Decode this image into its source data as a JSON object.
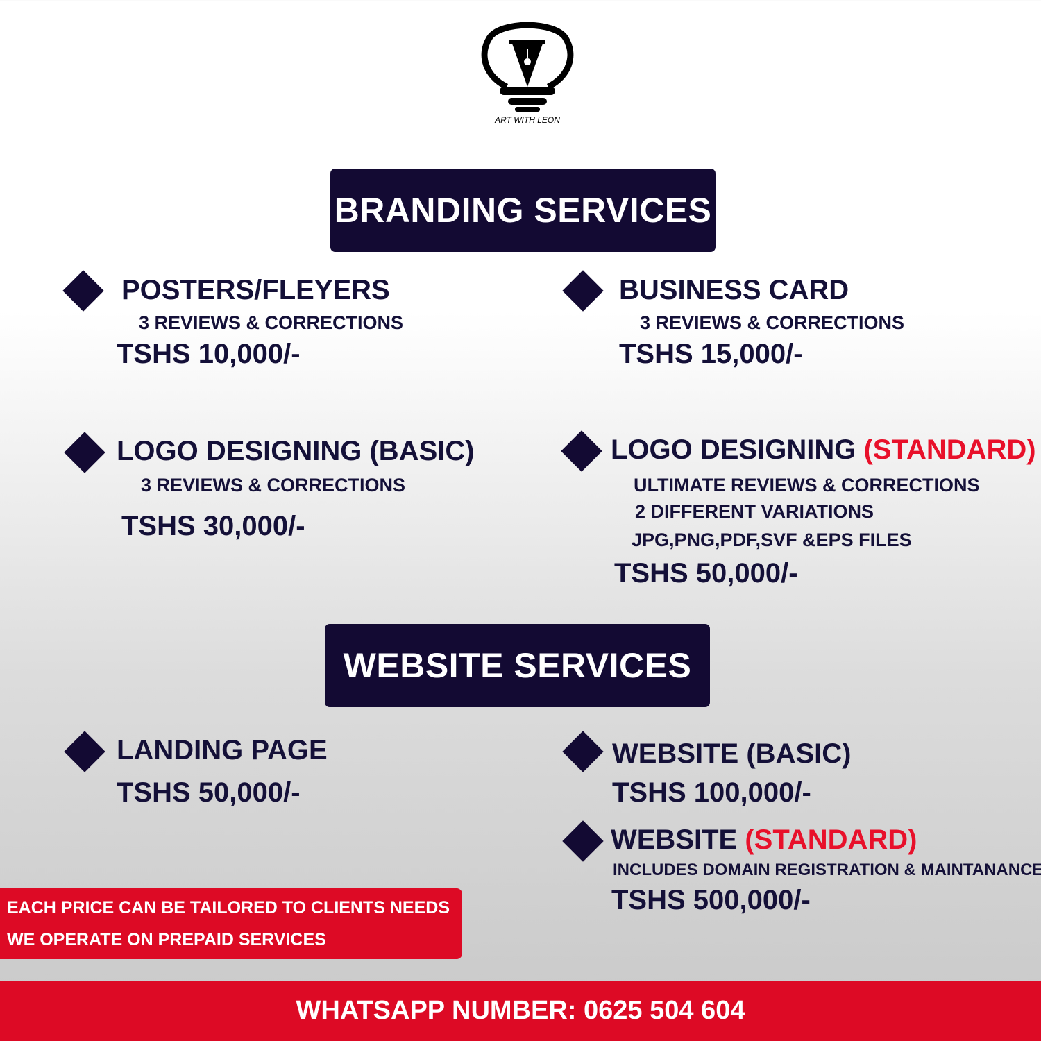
{
  "brand": {
    "logo_text": "ART WITH LEON"
  },
  "branding": {
    "heading": "BRANDING SERVICES",
    "posters": {
      "title": "POSTERS/FLEYERS",
      "detail": "3 REVIEWS & CORRECTIONS",
      "price": "TSHS 10,000/-"
    },
    "business_card": {
      "title": "BUSINESS CARD",
      "detail": "3 REVIEWS & CORRECTIONS",
      "price": "TSHS 15,000/-"
    },
    "logo_basic": {
      "title": "LOGO DESIGNING",
      "tier": "(BASIC)",
      "detail": "3 REVIEWS & CORRECTIONS",
      "price": "TSHS 30,000/-"
    },
    "logo_standard": {
      "title": "LOGO DESIGNING",
      "tier": "(STANDARD)",
      "details": [
        "ULTIMATE REVIEWS & CORRECTIONS",
        "2 DIFFERENT VARIATIONS",
        "JPG,PNG,PDF,SVF &EPS FILES"
      ],
      "price": "TSHS 50,000/-"
    }
  },
  "website": {
    "heading": "WEBSITE SERVICES",
    "landing": {
      "title": "LANDING PAGE",
      "price": "TSHS 50,000/-"
    },
    "basic": {
      "title": "WEBSITE",
      "tier": "(BASIC)",
      "price": "TSHS 100,000/-"
    },
    "standard": {
      "title": "WEBSITE",
      "tier": "(STANDARD)",
      "detail": "INCLUDES DOMAIN REGISTRATION & MAINTANANCE",
      "price": "TSHS 500,000/-"
    }
  },
  "notice": {
    "line1": "EACH PRICE CAN BE TAILORED TO CLIENTS NEEDS",
    "line2": "WE OPERATE ON PREPAID SERVICES"
  },
  "footer": {
    "whatsapp": "WHATSAPP NUMBER: 0625 504 604"
  },
  "colors": {
    "navy": "#130a33",
    "red": "#dd0a25",
    "accent_red_text": "#e8102a"
  }
}
